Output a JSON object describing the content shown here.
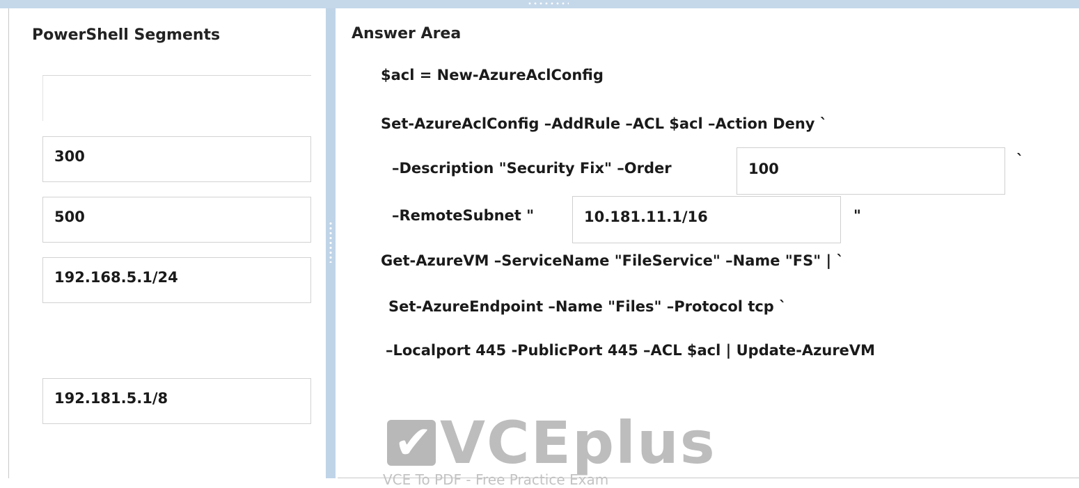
{
  "left_panel": {
    "title": "PowerShell Segments",
    "segments": [
      "300",
      "500",
      "192.168.5.1/24",
      "192.181.5.1/8"
    ]
  },
  "answer_area": {
    "title": "Answer Area",
    "lines": {
      "l1": "$acl = New-AzureAclConfig",
      "l2": "Set-AzureAclConfig –AddRule –ACL $acl –Action Deny `",
      "l3_prefix": "–Description \"Security Fix\" –Order",
      "l3_suffix": "`",
      "l4_prefix": "–RemoteSubnet \"",
      "l4_suffix": "\"",
      "l5": "Get-AzureVM –ServiceName \"FileService\" –Name \"FS\" | `",
      "l6": "Set-AzureEndpoint –Name \"Files\" –Protocol tcp `",
      "l7": "–Localport 445 -PublicPort 445 –ACL $acl | Update-AzureVM"
    },
    "drop_order": "100",
    "drop_subnet": "10.181.11.1/16"
  },
  "watermark": {
    "logo_glyph": "✔",
    "brand": "VCEplus",
    "tagline": "VCE To PDF - Free Practice Exam"
  },
  "colors": {
    "frame": "#c5d8ea",
    "splitter": "#c0d4e7",
    "watermark": "#bdbdbd"
  }
}
